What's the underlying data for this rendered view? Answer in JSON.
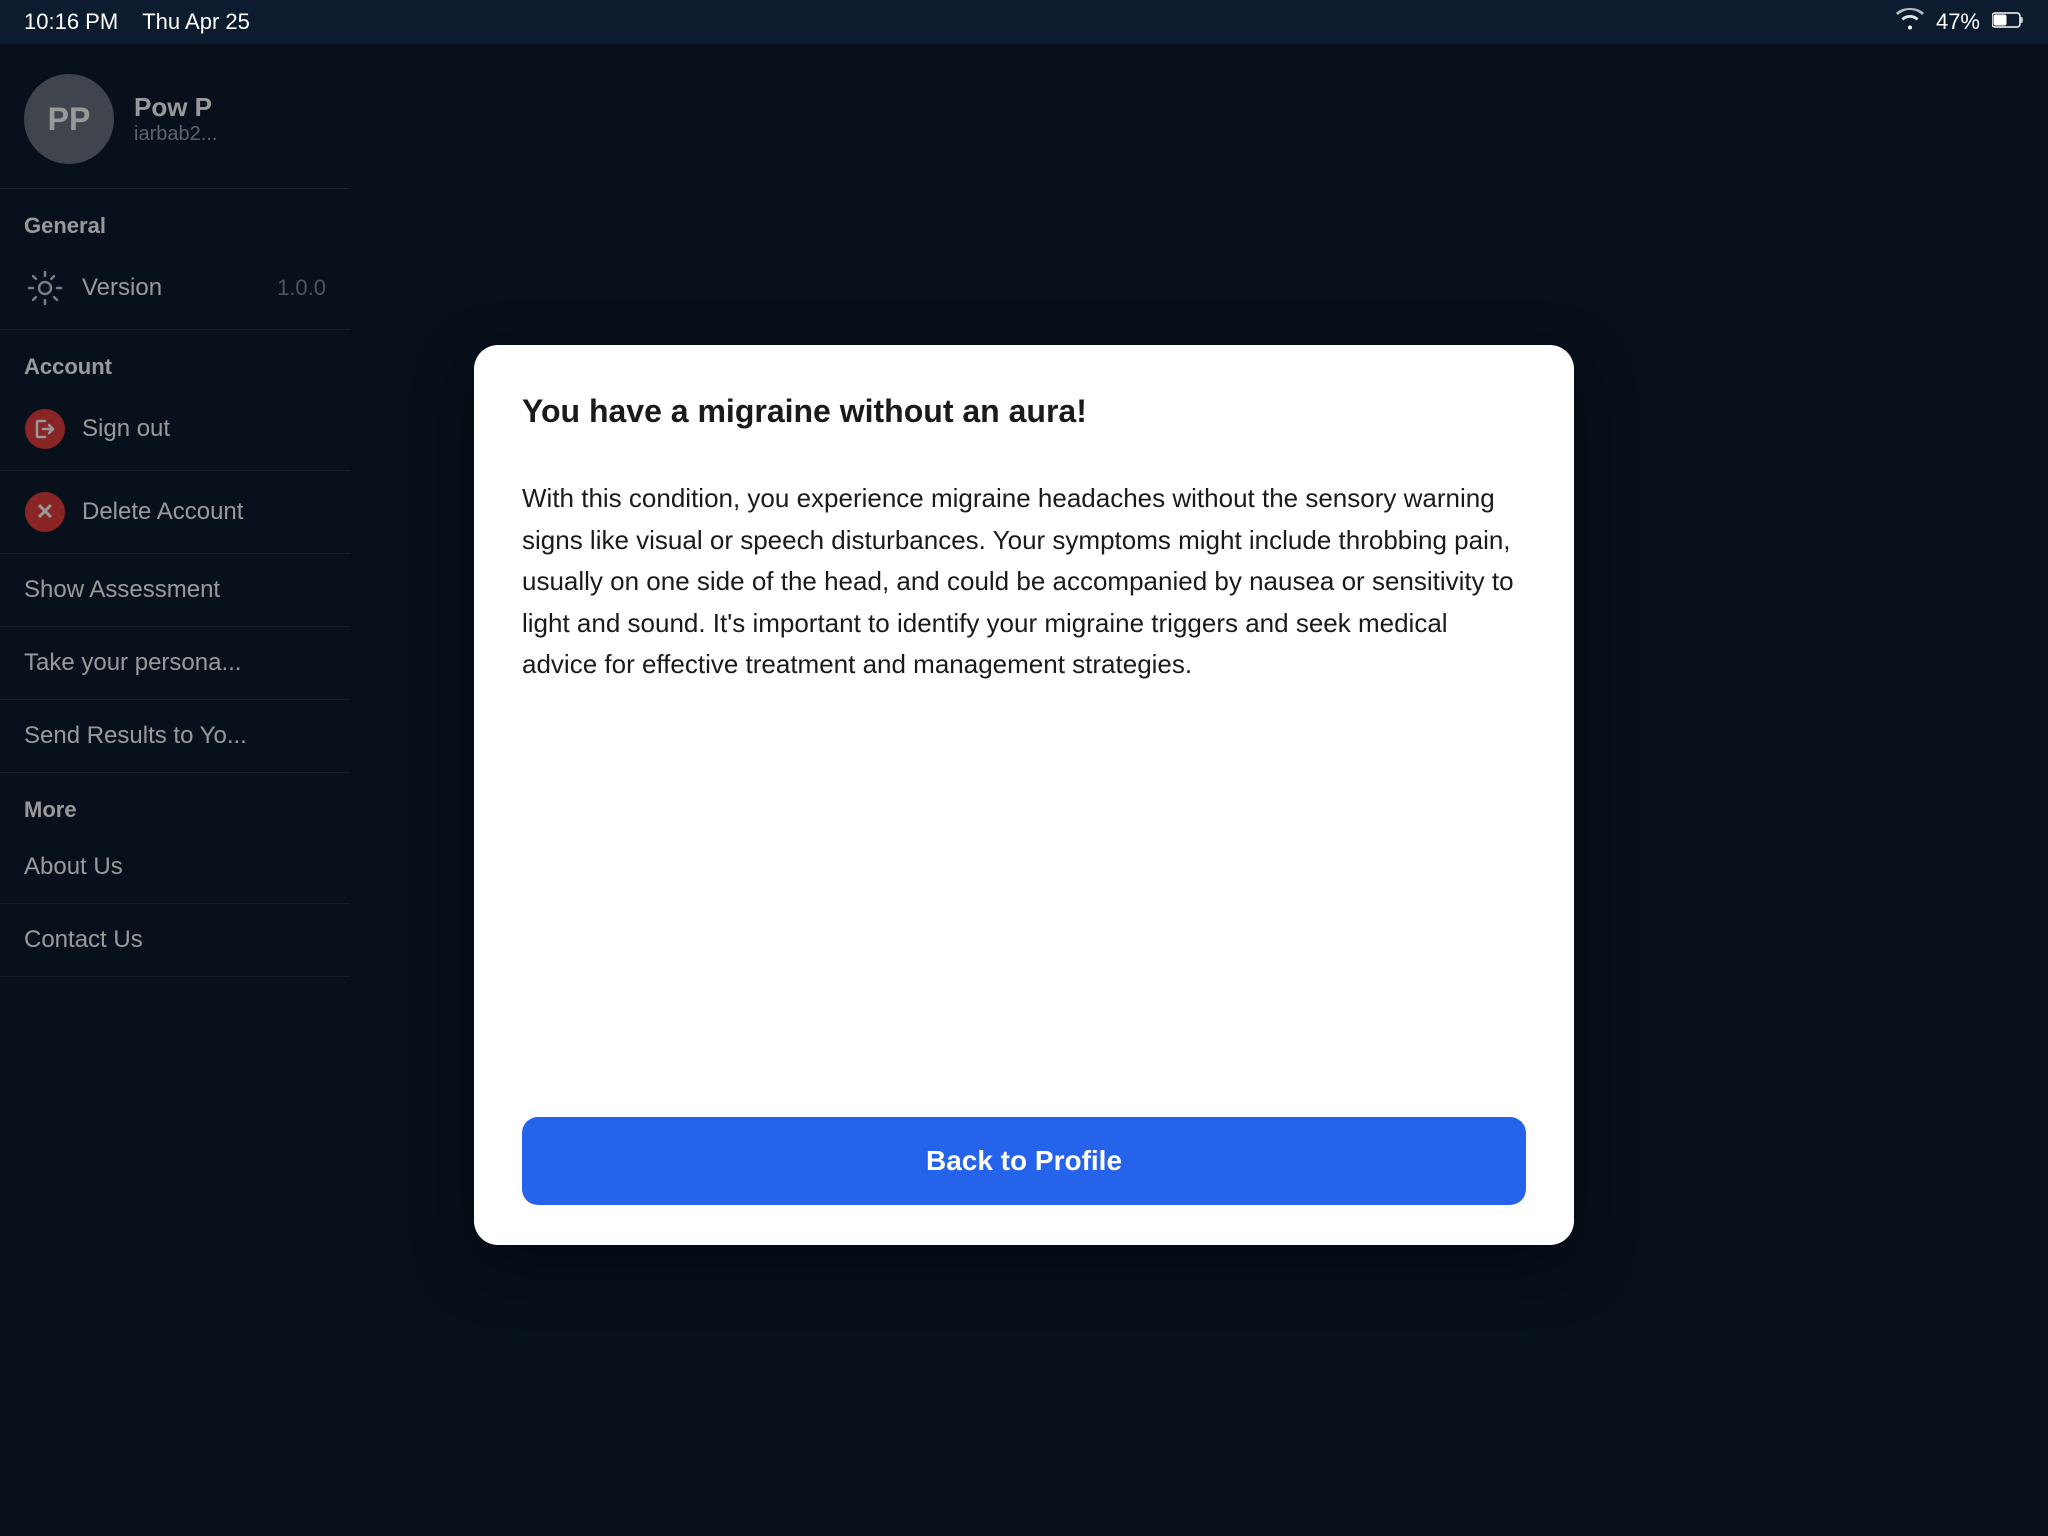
{
  "statusBar": {
    "time": "10:16 PM",
    "date": "Thu Apr 25",
    "battery": "47%",
    "batteryIcon": "🔋",
    "wifiIcon": "wifi"
  },
  "sidebar": {
    "profile": {
      "initials": "PP",
      "name": "Pow P",
      "email": "iarbab2..."
    },
    "general": {
      "sectionLabel": "General",
      "versionLabel": "Version",
      "versionValue": "1.0.0"
    },
    "account": {
      "sectionLabel": "Account",
      "signOutLabel": "Sign out",
      "deleteAccountLabel": "Delete Account"
    },
    "menuItems": [
      {
        "label": "Show Assessment"
      },
      {
        "label": "Take your persona..."
      },
      {
        "label": "Send Results to Yo..."
      }
    ],
    "more": {
      "sectionLabel": "More",
      "aboutUs": "About Us",
      "contactUs": "Contact Us"
    }
  },
  "modal": {
    "title": "You have a migraine without an aura!",
    "body": "With this condition, you experience migraine headaches without the sensory warning signs like visual or speech disturbances. Your symptoms might include throbbing pain, usually on one side of the head, and could be accompanied by nausea or sensitivity to light and sound. It's important to identify your migraine triggers and seek medical advice for effective treatment and management strategies.",
    "backButtonLabel": "Back to Profile"
  }
}
